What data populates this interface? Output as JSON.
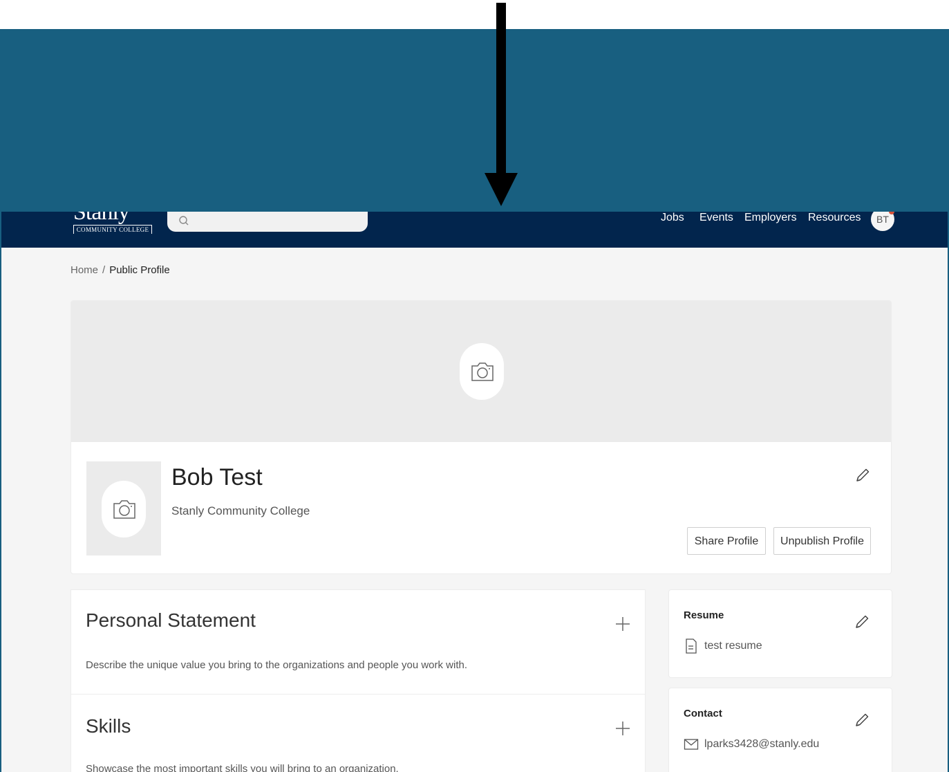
{
  "nav": {
    "logo_word": "Stanly",
    "logo_sub": "COMMUNITY COLLEGE",
    "links": [
      "Jobs",
      "Events",
      "Employers",
      "Resources"
    ],
    "avatar_initials": "BT"
  },
  "breadcrumb": {
    "home": "Home",
    "separator": "/",
    "current": "Public Profile"
  },
  "profile": {
    "name": "Bob Test",
    "organization": "Stanly Community College",
    "share_button": "Share Profile",
    "unpublish_button": "Unpublish Profile"
  },
  "sections": {
    "personal_statement": {
      "title": "Personal Statement",
      "description": "Describe the unique value you bring to the organizations and people you work with."
    },
    "skills": {
      "title": "Skills",
      "description": "Showcase the most important skills you will bring to an organization."
    }
  },
  "sidebar": {
    "resume": {
      "title": "Resume",
      "item": "test resume"
    },
    "contact": {
      "title": "Contact",
      "item": "lparks3428@stanly.edu"
    }
  },
  "colors": {
    "banner": "#185f80",
    "navbar": "#02254d",
    "arrow": "#000000",
    "page_bg": "#f5f5f5"
  }
}
